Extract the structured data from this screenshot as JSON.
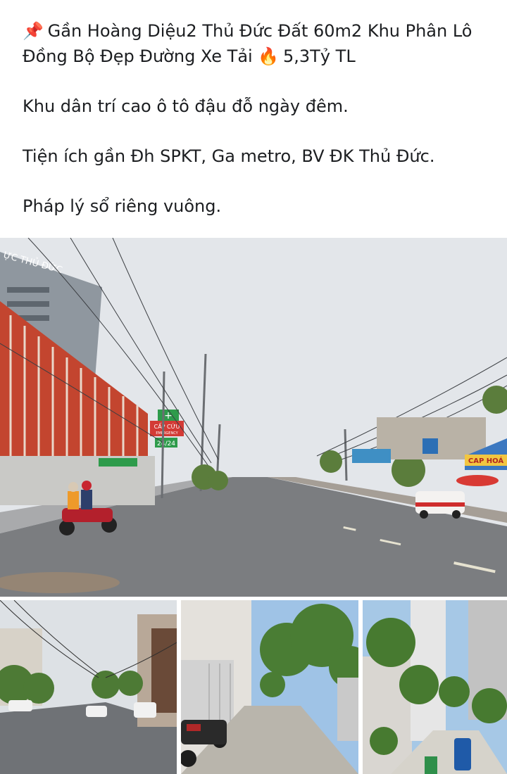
{
  "post": {
    "pin_icon": "pushpin-icon",
    "fire_icon": "fire-icon",
    "title_line1": "Gần Hoàng Diệu2 Thủ Đức Đất 60m2 Khu Phân Lô",
    "title_line2": "Đồng Bộ Đẹp Đường Xe Tải",
    "price": "5,3Tỷ TL",
    "line2": "Khu dân trí cao ô tô đậu đỗ ngày đêm.",
    "line3": "Tiện ích gần Đh SPKT, Ga metro, BV ĐK Thủ Đức.",
    "line4": "Pháp lý sổ riêng vuông."
  },
  "photos": {
    "main": {
      "signs": {
        "building": "ỰC THỦ ĐỨC",
        "pharmacy": "CẤP CỨU",
        "pharmacy_sub": "EMERGENCY",
        "pharmacy_hours": "24/24",
        "shop": "CAP HOÁ"
      }
    }
  },
  "colors": {
    "text": "#1c1e21",
    "sky": "#dfe3e8",
    "road": "#7d7f82",
    "red_building": "#c0412e",
    "green_sign": "#2e9b4b"
  }
}
